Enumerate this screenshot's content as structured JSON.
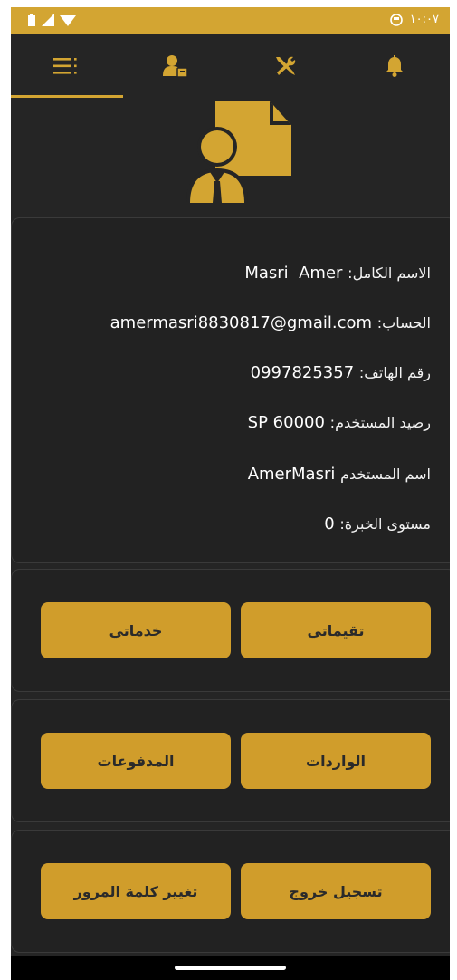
{
  "status_bar": {
    "time": "١٠:٠٧"
  },
  "tabs": [
    {
      "name": "menu",
      "icon": "menu-list-icon",
      "active": true
    },
    {
      "name": "account",
      "icon": "user-id-icon",
      "active": false
    },
    {
      "name": "services",
      "icon": "tools-icon",
      "active": false
    },
    {
      "name": "notifications",
      "icon": "bell-icon",
      "active": false
    }
  ],
  "profile_icon": "user-document-icon",
  "info": {
    "full_name_label": "الاسم الكامل:",
    "full_name_value": "Masri  Amer",
    "account_label": "الحساب:",
    "account_value": "amermasri8830817@gmail.com",
    "phone_label": "رقم الهاتف:",
    "phone_value": "0997825357",
    "balance_label": "رصيد المستخدم:",
    "balance_value": "60000",
    "balance_currency": "SP",
    "username_label": "اسم المستخدم",
    "username_value": "AmerMasri",
    "level_label": "مستوى الخبرة:",
    "level_value": "0"
  },
  "buttons": {
    "my_ratings": "تقيماتي",
    "my_services": "خدماتي",
    "incoming": "الواردات",
    "payments": "المدفوعات",
    "logout": "تسجيل خروج",
    "change_password": "تغيير كلمة المرور"
  },
  "colors": {
    "accent": "#d3a532",
    "button": "#d09d2b",
    "background": "#252525",
    "card": "#222222"
  }
}
